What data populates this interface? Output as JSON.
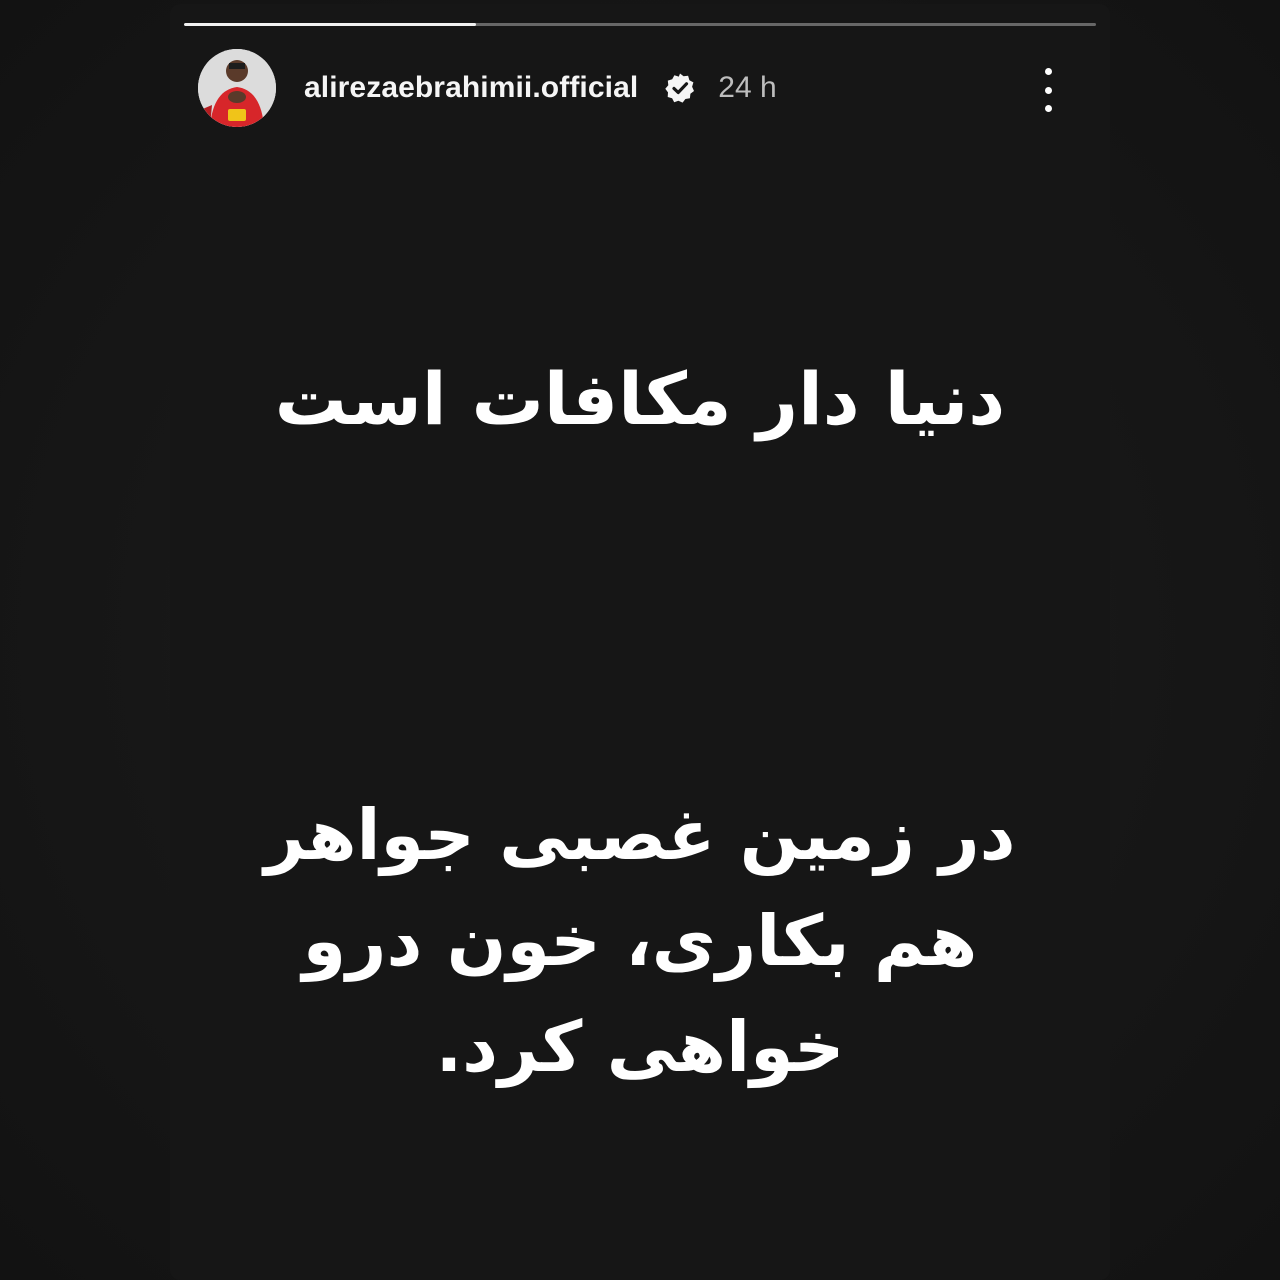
{
  "story": {
    "progress_fraction": 0.32,
    "username": "alirezaebrahimii.official",
    "verified_icon": "verified-badge-icon",
    "time": "24 h",
    "more_icon": "more-vertical-icon",
    "text_primary": "دنیا دار مکافات است",
    "text_secondary": "در زمین غصبی جواهر هم بکاری، خون درو خواهی کرد.",
    "colors": {
      "background": "#161616",
      "text": "#ffffff",
      "progress_fill": "#f2f2f2"
    }
  }
}
